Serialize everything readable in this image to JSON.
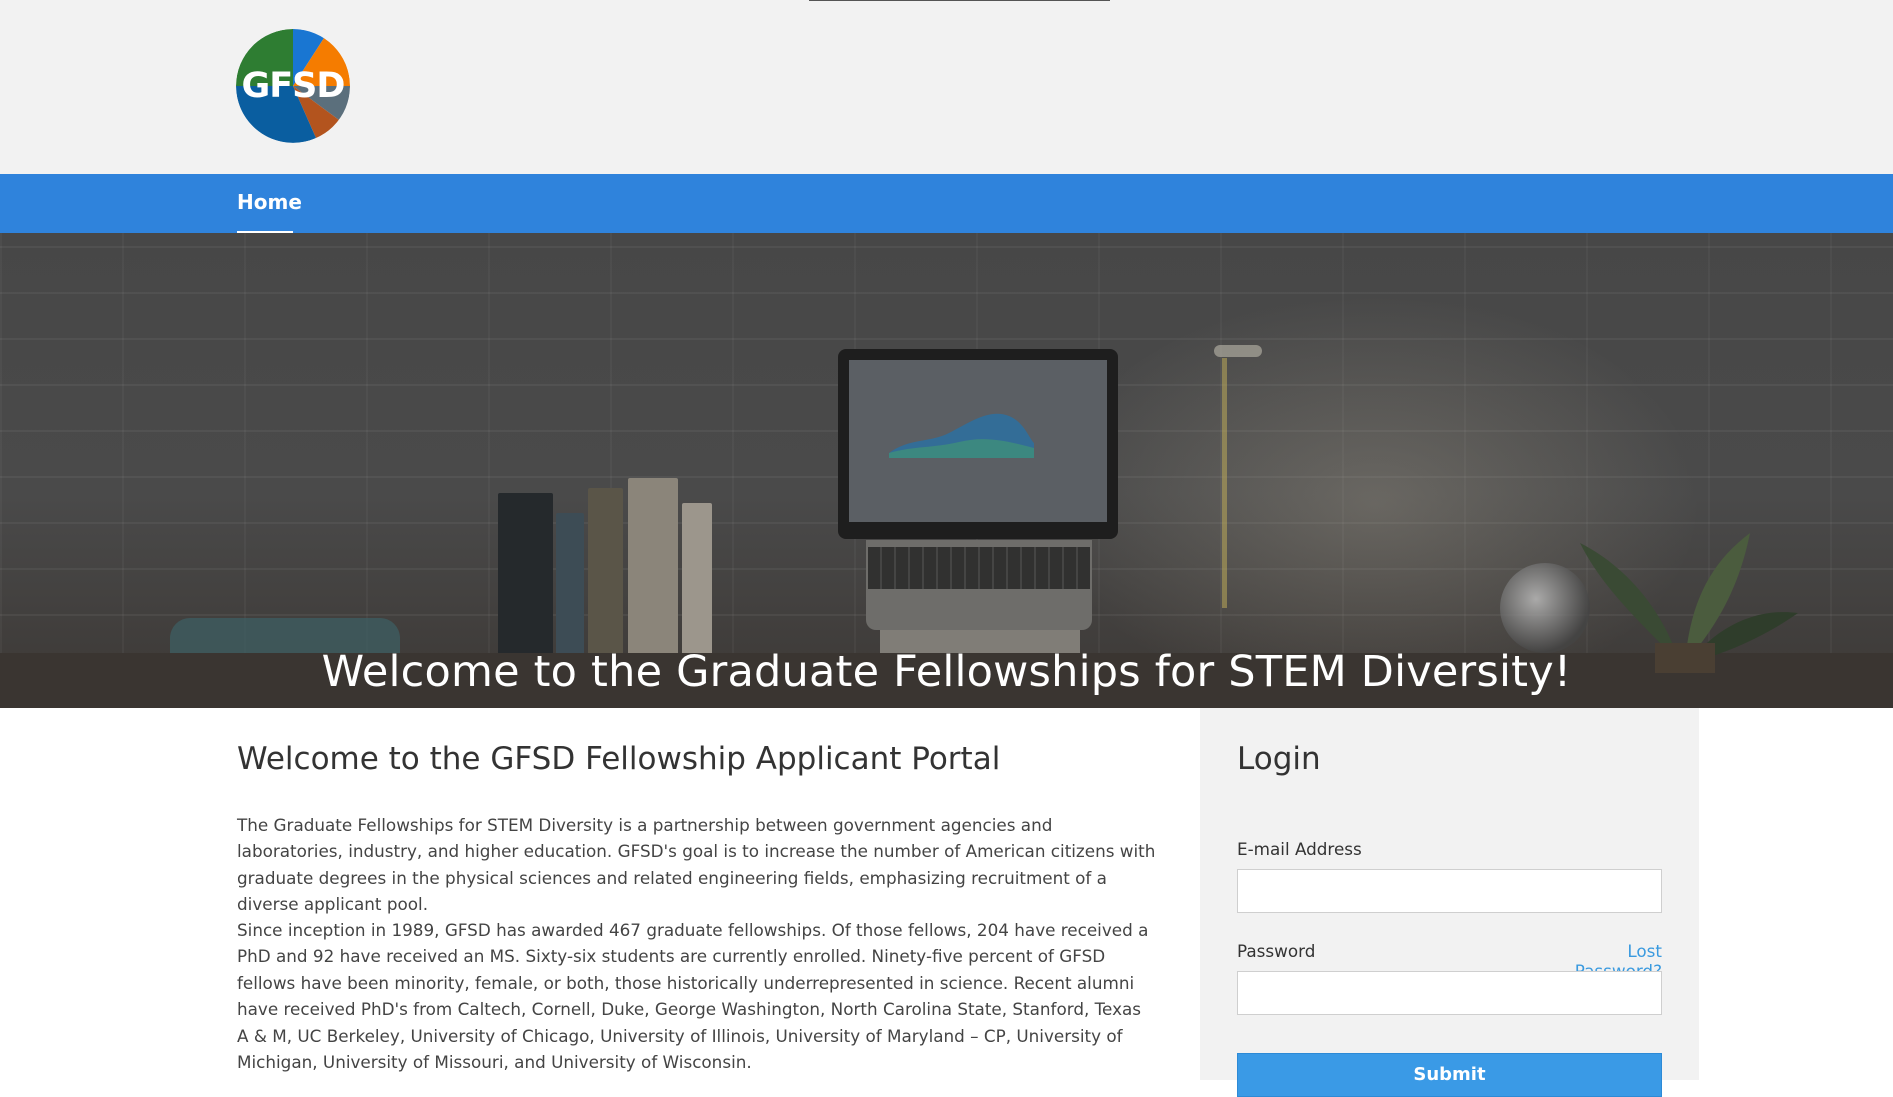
{
  "logo": {
    "text": "GFSD",
    "colors": [
      "#2e7d32",
      "#1976d2",
      "#f57c00",
      "#b3541e",
      "#0a5ea0"
    ]
  },
  "nav": {
    "home_label": "Home"
  },
  "hero": {
    "title": "Welcome to the Graduate Fellowships for STEM Diversity!"
  },
  "main": {
    "title": "Welcome to the GFSD Fellowship Applicant Portal",
    "paragraphs": [
      "The Graduate Fellowships for STEM Diversity is a partnership between government agencies and laboratories, industry, and higher education. GFSD's goal is to increase the number of American citizens with graduate degrees in the physical sciences and related engineering fields, emphasizing recruitment of a diverse applicant pool.",
      "Since inception in 1989, GFSD has awarded 467 graduate fellowships. Of those fellows, 204 have received a PhD and 92 have received an MS. Sixty-six students are currently enrolled. Ninety-five percent of GFSD fellows have been minority, female, or both, those historically underrepresented in science. Recent alumni have received PhD's from Caltech, Cornell, Duke, George Washington, North Carolina State, Stanford, Texas A & M, UC Berkeley, University of Chicago, University of Illinois, University of Maryland – CP, University of Michigan, University of Missouri, and University of Wisconsin."
    ]
  },
  "login": {
    "title": "Login",
    "email_label": "E-mail Address",
    "email_value": "",
    "password_label": "Password",
    "password_value": "",
    "lost_password": "Lost Password?",
    "submit_label": "Submit"
  },
  "colors": {
    "nav_background": "#2f83dc",
    "link": "#3a9adf",
    "submit_background": "#3a9ae6",
    "panel_background": "#f2f2f2"
  }
}
